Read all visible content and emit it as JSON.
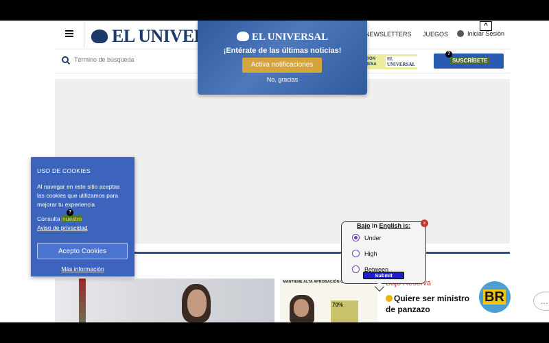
{
  "header": {
    "logo_text": "EL UNIVERSAL",
    "nav_items": [
      "NEWSLETTERS",
      "JUEGOS"
    ],
    "login_label": "Iniciar Sesión",
    "scroll_up_glyph": "^"
  },
  "search": {
    "placeholder": "Término de búsqueda"
  },
  "promo": {
    "line1": "CIÓN",
    "line2": "RESA",
    "brand": "EL UNIVERSAL"
  },
  "subscribe": {
    "label": "SUSCRÍBETE",
    "help_glyph": "?"
  },
  "notification": {
    "logo_text": "EL UNIVERSAL",
    "title": "¡Entérate de las últimas noticias!",
    "activate_label": "Activa notificaciones",
    "decline_label": "No, gracias"
  },
  "cookies": {
    "title": "USO DE COOKIES",
    "body": "Al navegar en este sitio aceptas las cookies que utilizamos para mejorar tu experiencia",
    "consult_prefix": "Consulta",
    "consult_highlight": "nuestro",
    "privacy_link": "Aviso de privacidad",
    "accept_label": "Acepto Cookies",
    "more_info_link": "Más información",
    "help_glyph": "?"
  },
  "quiz": {
    "word": "Bajo",
    "in": "in",
    "language": "English is:",
    "options": [
      "Under",
      "High",
      "Between"
    ],
    "selected_index": 0,
    "submit_label": "Submit",
    "close_label": "x"
  },
  "articles": {
    "infographic_heading": "MANTIENE ALTA APROBACIÓN C",
    "infographic_value": "70%",
    "section_label": "Bajo Reserva",
    "headline": "Quiere ser ministro de panzazo",
    "brand_badge": "BR"
  },
  "chat_glyph": "…"
}
